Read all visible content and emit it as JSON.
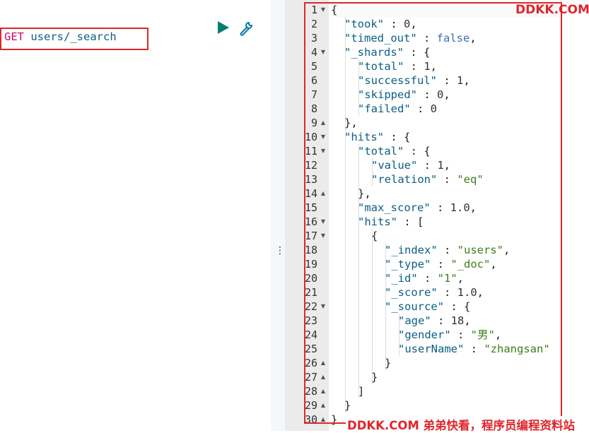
{
  "request": {
    "method": "GET",
    "path": "users/_search"
  },
  "toolbar": {
    "run_icon": "play-icon",
    "settings_icon": "wrench-icon",
    "accent_color": "#017d73"
  },
  "response": {
    "lines": [
      {
        "n": "1",
        "fold": "down",
        "indent": 0,
        "tokens": [
          [
            "punc",
            "{"
          ]
        ]
      },
      {
        "n": "2",
        "fold": "",
        "indent": 1,
        "tokens": [
          [
            "key",
            "\"took\""
          ],
          [
            "punc",
            " : "
          ],
          [
            "num",
            "0"
          ],
          [
            "punc",
            ","
          ]
        ]
      },
      {
        "n": "3",
        "fold": "",
        "indent": 1,
        "tokens": [
          [
            "key",
            "\"timed_out\""
          ],
          [
            "punc",
            " : "
          ],
          [
            "bool",
            "false"
          ],
          [
            "punc",
            ","
          ]
        ]
      },
      {
        "n": "4",
        "fold": "down",
        "indent": 1,
        "tokens": [
          [
            "key",
            "\"_shards\""
          ],
          [
            "punc",
            " : {"
          ]
        ]
      },
      {
        "n": "5",
        "fold": "",
        "indent": 2,
        "tokens": [
          [
            "key",
            "\"total\""
          ],
          [
            "punc",
            " : "
          ],
          [
            "num",
            "1"
          ],
          [
            "punc",
            ","
          ]
        ]
      },
      {
        "n": "6",
        "fold": "",
        "indent": 2,
        "tokens": [
          [
            "key",
            "\"successful\""
          ],
          [
            "punc",
            " : "
          ],
          [
            "num",
            "1"
          ],
          [
            "punc",
            ","
          ]
        ]
      },
      {
        "n": "7",
        "fold": "",
        "indent": 2,
        "tokens": [
          [
            "key",
            "\"skipped\""
          ],
          [
            "punc",
            " : "
          ],
          [
            "num",
            "0"
          ],
          [
            "punc",
            ","
          ]
        ]
      },
      {
        "n": "8",
        "fold": "",
        "indent": 2,
        "tokens": [
          [
            "key",
            "\"failed\""
          ],
          [
            "punc",
            " : "
          ],
          [
            "num",
            "0"
          ]
        ]
      },
      {
        "n": "9",
        "fold": "up",
        "indent": 1,
        "tokens": [
          [
            "punc",
            "},"
          ]
        ]
      },
      {
        "n": "10",
        "fold": "down",
        "indent": 1,
        "tokens": [
          [
            "key",
            "\"hits\""
          ],
          [
            "punc",
            " : {"
          ]
        ]
      },
      {
        "n": "11",
        "fold": "down",
        "indent": 2,
        "tokens": [
          [
            "key",
            "\"total\""
          ],
          [
            "punc",
            " : {"
          ]
        ]
      },
      {
        "n": "12",
        "fold": "",
        "indent": 3,
        "tokens": [
          [
            "key",
            "\"value\""
          ],
          [
            "punc",
            " : "
          ],
          [
            "num",
            "1"
          ],
          [
            "punc",
            ","
          ]
        ]
      },
      {
        "n": "13",
        "fold": "",
        "indent": 3,
        "tokens": [
          [
            "key",
            "\"relation\""
          ],
          [
            "punc",
            " : "
          ],
          [
            "str",
            "\"eq\""
          ]
        ]
      },
      {
        "n": "14",
        "fold": "up",
        "indent": 2,
        "tokens": [
          [
            "punc",
            "},"
          ]
        ]
      },
      {
        "n": "15",
        "fold": "",
        "indent": 2,
        "tokens": [
          [
            "key",
            "\"max_score\""
          ],
          [
            "punc",
            " : "
          ],
          [
            "num",
            "1.0"
          ],
          [
            "punc",
            ","
          ]
        ]
      },
      {
        "n": "16",
        "fold": "down",
        "indent": 2,
        "tokens": [
          [
            "key",
            "\"hits\""
          ],
          [
            "punc",
            " : ["
          ]
        ]
      },
      {
        "n": "17",
        "fold": "down",
        "indent": 3,
        "tokens": [
          [
            "punc",
            "{"
          ]
        ]
      },
      {
        "n": "18",
        "fold": "",
        "indent": 4,
        "tokens": [
          [
            "key",
            "\"_index\""
          ],
          [
            "punc",
            " : "
          ],
          [
            "str",
            "\"users\""
          ],
          [
            "punc",
            ","
          ]
        ]
      },
      {
        "n": "19",
        "fold": "",
        "indent": 4,
        "tokens": [
          [
            "key",
            "\"_type\""
          ],
          [
            "punc",
            " : "
          ],
          [
            "str",
            "\"_doc\""
          ],
          [
            "punc",
            ","
          ]
        ]
      },
      {
        "n": "20",
        "fold": "",
        "indent": 4,
        "tokens": [
          [
            "key",
            "\"_id\""
          ],
          [
            "punc",
            " : "
          ],
          [
            "str",
            "\"1\""
          ],
          [
            "punc",
            ","
          ]
        ]
      },
      {
        "n": "21",
        "fold": "",
        "indent": 4,
        "tokens": [
          [
            "key",
            "\"_score\""
          ],
          [
            "punc",
            " : "
          ],
          [
            "num",
            "1.0"
          ],
          [
            "punc",
            ","
          ]
        ]
      },
      {
        "n": "22",
        "fold": "down",
        "indent": 4,
        "tokens": [
          [
            "key",
            "\"_source\""
          ],
          [
            "punc",
            " : {"
          ]
        ]
      },
      {
        "n": "23",
        "fold": "",
        "indent": 5,
        "tokens": [
          [
            "key",
            "\"age\""
          ],
          [
            "punc",
            " : "
          ],
          [
            "num",
            "18"
          ],
          [
            "punc",
            ","
          ]
        ]
      },
      {
        "n": "24",
        "fold": "",
        "indent": 5,
        "tokens": [
          [
            "key",
            "\"gender\""
          ],
          [
            "punc",
            " : "
          ],
          [
            "str",
            "\"男\""
          ],
          [
            "punc",
            ","
          ]
        ]
      },
      {
        "n": "25",
        "fold": "",
        "indent": 5,
        "tokens": [
          [
            "key",
            "\"userName\""
          ],
          [
            "punc",
            " : "
          ],
          [
            "str",
            "\"zhangsan\""
          ]
        ]
      },
      {
        "n": "26",
        "fold": "up",
        "indent": 4,
        "tokens": [
          [
            "punc",
            "}"
          ]
        ]
      },
      {
        "n": "27",
        "fold": "up",
        "indent": 3,
        "tokens": [
          [
            "punc",
            "}"
          ]
        ]
      },
      {
        "n": "28",
        "fold": "up",
        "indent": 2,
        "tokens": [
          [
            "punc",
            "]"
          ]
        ]
      },
      {
        "n": "29",
        "fold": "up",
        "indent": 1,
        "tokens": [
          [
            "punc",
            "}"
          ]
        ]
      },
      {
        "n": "30",
        "fold": "up",
        "indent": 0,
        "tokens": [
          [
            "punc",
            "}"
          ]
        ]
      }
    ]
  },
  "watermark": {
    "top": "DDKK.COM",
    "bottom": "DDKK.COM 弟弟快看，程序员编程资料站"
  },
  "highlight_color": "#e0262b"
}
